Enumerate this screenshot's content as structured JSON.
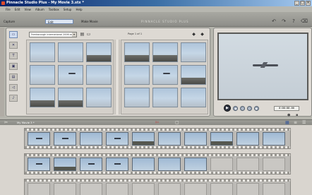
{
  "window": {
    "title": "Pinnacle Studio Plus - My Movie 3.stx *"
  },
  "menu": [
    "File",
    "Edit",
    "View",
    "Album",
    "Toolbox",
    "Setup",
    "Help"
  ],
  "modes": [
    {
      "label": "Capture",
      "active": false
    },
    {
      "label": "Edit",
      "active": true
    },
    {
      "label": "Make Movie",
      "active": false
    }
  ],
  "brand": "PINNACLE STUDIO PLUS",
  "album": {
    "source": "Farnborough International 2006.avi",
    "page_label": "Page 1 of 1",
    "left_thumbs": [
      "sky",
      "sky",
      "ground",
      "sky",
      "plane",
      "sky",
      "ground",
      "ground",
      "sky"
    ],
    "right_thumbs": [
      "ground",
      "ground",
      "sky",
      "sky",
      "plane",
      "ground",
      "sky",
      "sky",
      "sky"
    ]
  },
  "player": {
    "timecode": "0:00:00.00"
  },
  "timeline": {
    "movie_name": "My Movie 3 *"
  },
  "storyboard": {
    "row1": [
      "plane",
      "plane",
      "sky",
      "plane",
      "ground",
      "sky",
      "sky",
      "ground",
      "sky",
      "sky"
    ],
    "row2": [
      "plane",
      "ground",
      "plane",
      "plane",
      "sky",
      "sky",
      "sky",
      "empty",
      "empty",
      "empty"
    ],
    "row3": [
      "empty",
      "empty",
      "empty",
      "empty",
      "empty",
      "empty",
      "empty",
      "empty",
      "empty",
      "empty"
    ]
  }
}
